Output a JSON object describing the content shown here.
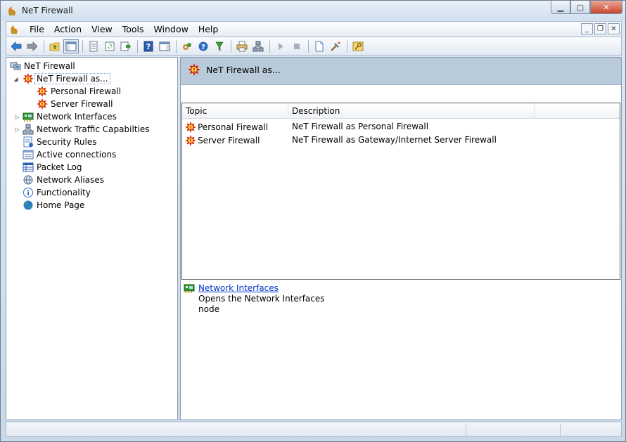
{
  "window": {
    "title": "NeT Firewall"
  },
  "menubar": {
    "items": [
      "File",
      "Action",
      "View",
      "Tools",
      "Window",
      "Help"
    ]
  },
  "toolbar": {
    "icons": [
      "back-arrow-icon",
      "forward-arrow-icon",
      "up-folder-icon",
      "show-hide-tree-icon",
      "properties-icon",
      "refresh-icon",
      "export-list-icon",
      "help-icon",
      "action-pane-icon",
      "connect-icon",
      "help-circle-icon",
      "filter-icon",
      "print-icon",
      "network-icon",
      "play-icon",
      "stop-icon",
      "new-document-icon",
      "tools-icon",
      "key-icon"
    ]
  },
  "tree": {
    "root": "NeT Firewall",
    "selected": "NeT Firewall as...",
    "children": [
      "Personal Firewall",
      "Server Firewall"
    ],
    "items": [
      "Network Interfaces",
      "Network Traffic Capabilties",
      "Security Rules",
      "Active connections",
      "Packet Log",
      "Network Aliases",
      "Functionality",
      "Home Page"
    ]
  },
  "content": {
    "header_title": "NeT Firewall as...",
    "columns": [
      "Topic",
      "Description"
    ],
    "rows": [
      {
        "topic": "Personal Firewall",
        "description": "NeT Firewall as Personal Firewall"
      },
      {
        "topic": "Server Firewall",
        "description": "NeT Firewall as Gateway/Internet Server Firewall"
      }
    ],
    "link_title": "Network Interfaces",
    "link_description": "Opens the Network Interfaces node"
  },
  "colors": {
    "header_band": "#b9cadb",
    "link": "#0033cc",
    "firewall_red": "#cc2200"
  }
}
